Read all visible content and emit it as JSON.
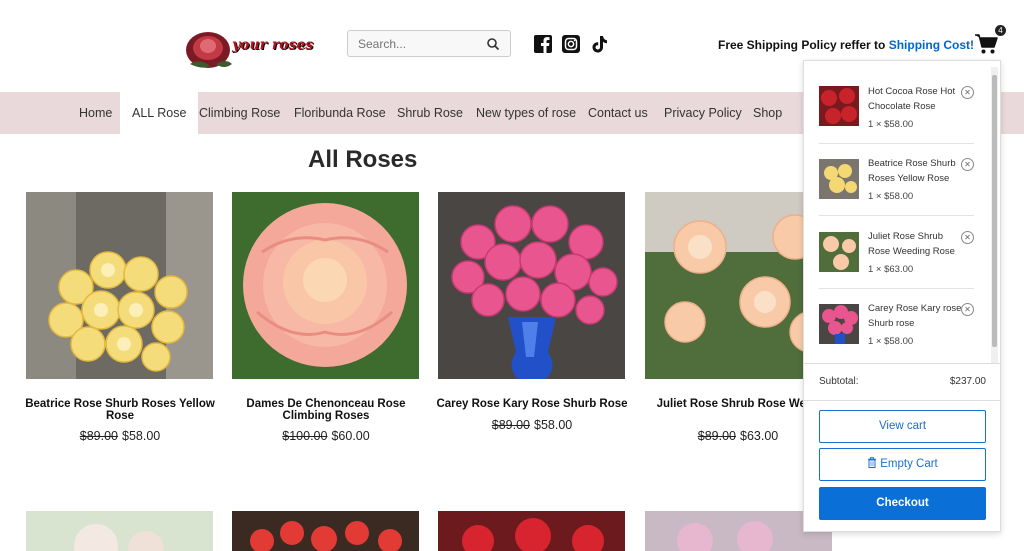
{
  "header": {
    "logo_text": "your roses",
    "search_placeholder": "Search...",
    "shipping_prefix": "Free Shipping Policy reffer to",
    "shipping_link": "Shipping Cost!",
    "cart_count": "4"
  },
  "nav": [
    "Home",
    "ALL Rose",
    "Climbing Rose",
    "Floribunda Rose",
    "Shrub Rose",
    "New types of rose",
    "Contact us",
    "Privacy Policy",
    "Shop"
  ],
  "page_title": "All Roses",
  "products": [
    {
      "name": "Beatrice Rose Shurb Roses Yellow Rose",
      "old_price": "$89.00",
      "price": "$58.00"
    },
    {
      "name": "Dames De Chenonceau Rose Climbing Roses",
      "old_price": "$100.00",
      "price": "$60.00"
    },
    {
      "name": "Carey Rose Kary Rose Shurb Rose",
      "old_price": "$89.00",
      "price": "$58.00"
    },
    {
      "name": "Juliet Rose Shrub Rose Weed",
      "old_price": "$89.00",
      "price": "$63.00"
    }
  ],
  "cart": {
    "items": [
      {
        "name": "Hot Cocoa Rose Hot Chocolate Rose",
        "qty": "1 × $58.00"
      },
      {
        "name": "Beatrice Rose Shurb Roses Yellow Rose",
        "qty": "1 × $58.00"
      },
      {
        "name": "Juliet Rose Shrub Rose Weeding Rose",
        "qty": "1 × $63.00"
      },
      {
        "name": "Carey Rose Kary rose Shurb rose",
        "qty": "1 × $58.00"
      }
    ],
    "subtotal_label": "Subtotal:",
    "subtotal_value": "$237.00",
    "view_cart": "View cart",
    "empty_cart": "Empty Cart",
    "checkout": "Checkout"
  },
  "colors": {
    "nav_bg": "#ead9da",
    "accent": "#0b6fd8"
  }
}
